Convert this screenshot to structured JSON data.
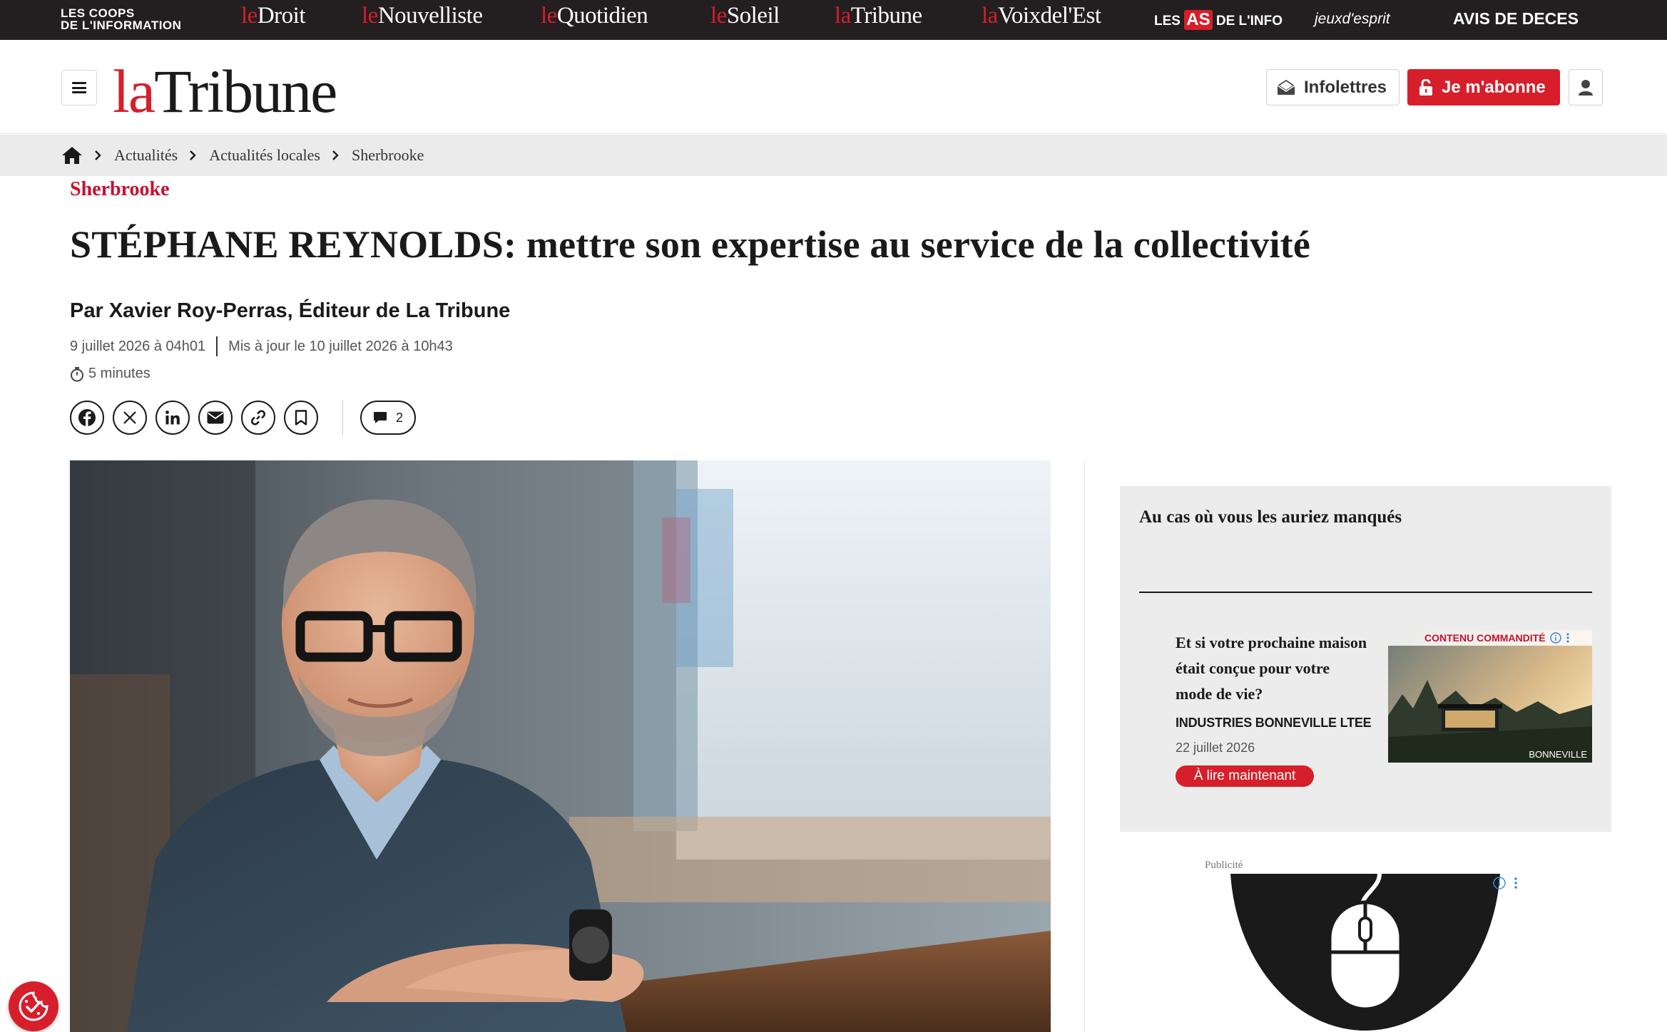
{
  "network_bar": {
    "coops_line1": "LES COOPS",
    "coops_line2": "DE L'INFORMATION",
    "sites": [
      {
        "pre": "le",
        "name": "Droit"
      },
      {
        "pre": "le",
        "name": "Nouvelliste"
      },
      {
        "pre": "le",
        "name": "Quotidien"
      },
      {
        "pre": "le",
        "name": "Soleil"
      },
      {
        "pre": "la",
        "name": "Tribune"
      },
      {
        "pre": "la",
        "name": "Voixdel'Est"
      }
    ],
    "las_pre": "LES",
    "las_as": "AS",
    "las_post": "DE L'INFO",
    "jeux": "jeuxd'esprit",
    "avis": "AVIS DE DECES"
  },
  "header": {
    "logo_pre": "la",
    "logo_name": "Tribune",
    "newsletters_label": "Infolettres",
    "subscribe_label": "Je m'abonne"
  },
  "breadcrumb": {
    "items": [
      "Actualités",
      "Actualités locales",
      "Sherbrooke"
    ]
  },
  "article": {
    "kicker": "Sherbrooke",
    "title": "STÉPHANE REYNOLDS: mettre son expertise au service de la collectivité",
    "byline": "Par Xavier Roy-Perras, Éditeur de La Tribune",
    "published": "9 juillet 2026 à 04h01",
    "updated": "Mis à jour le 10 juillet 2026 à 10h43",
    "read_time": "5 minutes",
    "comment_count": "2"
  },
  "sidebar": {
    "card_title": "Au cas où vous les auriez manqués",
    "sponsored": {
      "title": "Et si votre prochaine maison était conçue pour votre mode de vie?",
      "sponsor": "INDUSTRIES BONNEVILLE LTEE",
      "date": "22 juillet 2026",
      "cta": "À lire maintenant",
      "tag": "CONTENU COMMANDITÉ",
      "image_brand": "BONNEVILLE"
    },
    "ad_label": "Publicité"
  },
  "colors": {
    "brand_red": "#d61f2b",
    "kicker_red": "#c4122f",
    "netbar_bg": "#231f20",
    "breadcrumb_bg": "#ebebeb",
    "card_bg": "#ececec"
  },
  "icons": [
    "home-icon",
    "chevron-right-icon",
    "menu-icon",
    "envelope-icon",
    "lock-icon",
    "user-icon",
    "stopwatch-icon",
    "facebook-icon",
    "x-icon",
    "linkedin-icon",
    "email-icon",
    "link-icon",
    "bookmark-icon",
    "comment-icon",
    "info-icon",
    "kebab-icon",
    "cookie-consent-icon"
  ]
}
